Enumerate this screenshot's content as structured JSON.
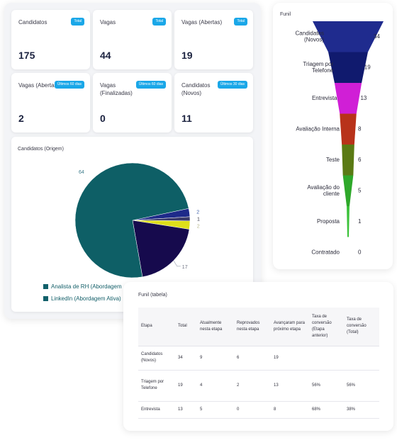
{
  "kpis": [
    {
      "label": "Candidatos",
      "badge": "Total",
      "value": "175"
    },
    {
      "label": "Vagas",
      "badge": "Total",
      "value": "44"
    },
    {
      "label": "Vagas (Abertas)",
      "badge": "Total",
      "value": "19"
    },
    {
      "label": "Vagas (Abertas)",
      "badge": "Últimos 60 dias",
      "value": "2"
    },
    {
      "label": "Vagas (Finalizadas)",
      "badge": "Últimos 60 dias",
      "value": "0"
    },
    {
      "label": "Candidatos (Novos)",
      "badge": "Últimos 30 dias",
      "value": "11"
    }
  ],
  "origem": {
    "title": "Candidatos (Origem)",
    "legend": [
      "Analista de RH (Abordagem",
      "LinkedIn (Abordagem Ativa)"
    ]
  },
  "funil": {
    "title": "Funil"
  },
  "tabela": {
    "title": "Funil (tabela)",
    "headers": [
      "Etapa",
      "Total",
      "Atualmente nesta etapa",
      "Reprovados nesta etapa",
      "Avançaram para próximo etapa",
      "Taxa de conversão (Etapa anterior)",
      "Taxa de conversão (Total)"
    ],
    "rows": [
      [
        "Candidatos (Novos)",
        "34",
        "9",
        "6",
        "19",
        "",
        ""
      ],
      [
        "Triagem por Telefone",
        "19",
        "4",
        "2",
        "13",
        "56%",
        "56%"
      ],
      [
        "Entrevista",
        "13",
        "5",
        "0",
        "8",
        "68%",
        "38%"
      ]
    ]
  },
  "chart_data": [
    {
      "type": "pie",
      "title": "Candidatos (Origem)",
      "labels": [
        "Analista de RH (Abordagem",
        "LinkedIn (Abordagem Ativa)",
        "",
        "",
        ""
      ],
      "values": [
        64,
        17,
        2,
        2,
        1
      ],
      "colors": [
        "#0e5f66",
        "#160a4d",
        "#1e2a8a",
        "#dede1a",
        "#3a3a6a"
      ],
      "data_labels": [
        "64",
        "17",
        "2",
        "1",
        "2"
      ]
    },
    {
      "type": "bar",
      "subtype": "funnel",
      "title": "Funil",
      "categories": [
        "Candidatos (Novos)",
        "Triagem por Telefone",
        "Entrevista",
        "Avaliação Interna",
        "Teste",
        "Avaliação do cliente",
        "Proposta",
        "Contratado"
      ],
      "values": [
        34,
        19,
        13,
        8,
        6,
        5,
        1,
        0
      ],
      "colors": [
        "#1f2b8e",
        "#101a6e",
        "#d01fd6",
        "#b8321a",
        "#5a7a14",
        "#2ea82a",
        "#3cc23a",
        "#3cc23a"
      ]
    }
  ]
}
